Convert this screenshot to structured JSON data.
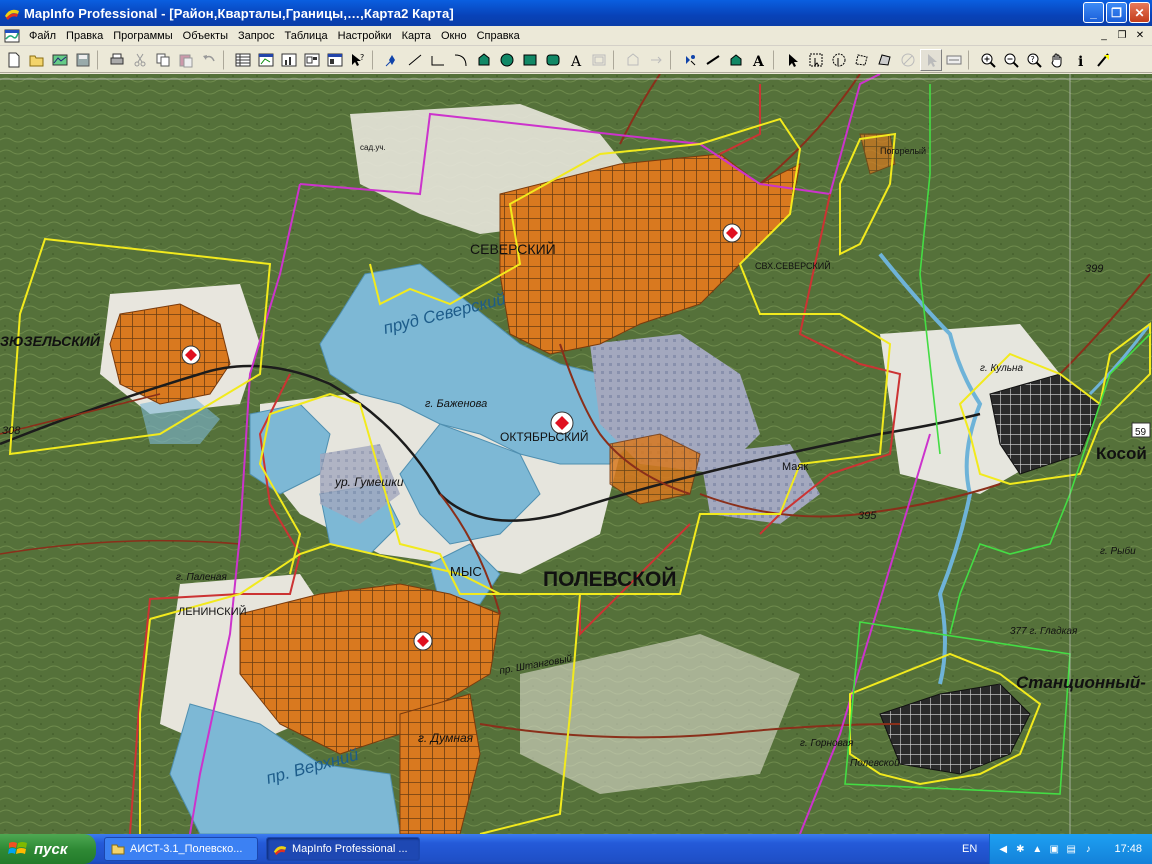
{
  "window": {
    "title": "MapInfo Professional - [Район,Кварталы,Границы,…,Карта2 Карта]"
  },
  "menubar": {
    "items": [
      "Файл",
      "Правка",
      "Программы",
      "Объекты",
      "Запрос",
      "Таблица",
      "Настройки",
      "Карта",
      "Окно",
      "Справка"
    ]
  },
  "toolbar": {
    "icons": [
      "new-icon",
      "open-icon",
      "open-workspace-icon",
      "save-icon",
      "print-icon",
      "cut-icon",
      "copy-icon",
      "paste-icon",
      "undo-icon",
      "new-browser-icon",
      "new-mapper-icon",
      "new-grapher-icon",
      "new-layout-icon",
      "new-redistrict-icon",
      "help-pointer-icon",
      "symbol-icon",
      "line-icon",
      "polyline-icon",
      "arc-icon",
      "polygon-icon",
      "ellipse-icon",
      "rectangle-icon",
      "rounded-rectangle-icon",
      "text-icon",
      "frame-icon",
      "reshape-icon",
      "add-node-icon",
      "symbol-style-icon",
      "line-style-icon",
      "region-style-icon",
      "text-style-icon",
      "select-icon",
      "marquee-select-icon",
      "radius-select-icon",
      "polygon-select-icon",
      "boundary-select-icon",
      "unselect-all-icon",
      "graph-select-icon",
      "label-icon",
      "drag-map-window-icon",
      "zoom-in-icon",
      "zoom-out-icon",
      "change-view-icon",
      "grabber-icon",
      "info-icon",
      "ruler-icon"
    ]
  },
  "map": {
    "labels": {
      "severskiy": "СЕВЕРСКИЙ",
      "svkh_severskiy": "СВХ.СЕВЕРСКИЙ",
      "zyuzelskiy": "ЗЮЗЕЛЬСКИЙ",
      "prud_severskiy": "пруд Северский",
      "bazhenova": "г. Баженова",
      "oktyabrskiy": "ОКТЯБРЬСКИЙ",
      "gumeshki": "ур. Гумешки",
      "mys": "МЫС",
      "polevskoy": "ПОЛЕВСКОЙ",
      "leninskiy": "ЛЕНИНСКИЙ",
      "palenaya": "г. Паленая",
      "verkhniy": "пр. Верхний",
      "dumnaya": "г. Думная",
      "kosoy": "Косой",
      "stantsionnyy": "Станционный-",
      "kulnaya": "г. Кульна",
      "mayak": "Маяк",
      "pogorelyy": "Погорелый",
      "gladkaya": "377 г. Гладкая",
      "shtangovyy": "пр. Штанговый",
      "rybnikovaya": "г. Рыби",
      "gornovaya": "г. Горновая",
      "polevskoy_small": "Полевской",
      "hwy59": "59",
      "elev399": "399",
      "elev395": "395",
      "elev308": "308",
      "sad": "сад.уч."
    }
  },
  "taskbar": {
    "start_label": "пуск",
    "tasks": [
      {
        "label": "АИСТ-3.1_Полевско...",
        "active": false
      },
      {
        "label": "MapInfo Professional ...",
        "active": true
      }
    ],
    "lang": "EN",
    "clock": "17:48"
  }
}
